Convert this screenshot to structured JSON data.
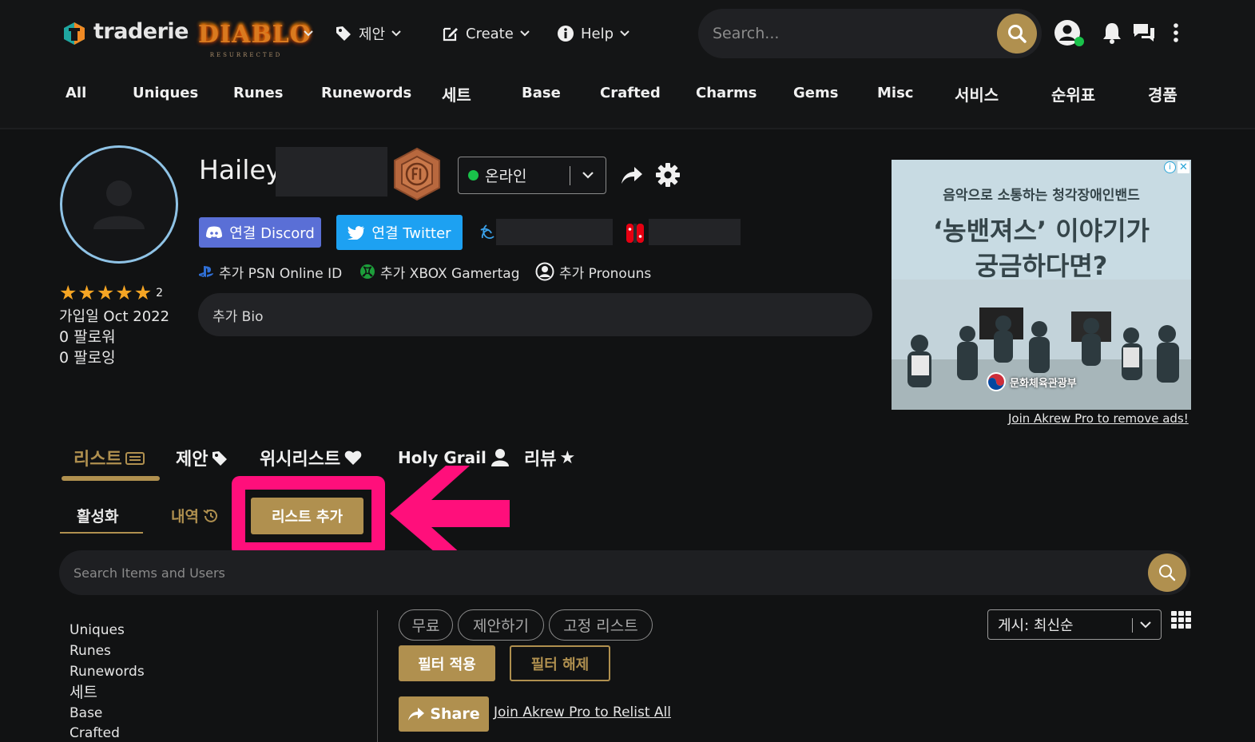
{
  "header": {
    "logo_text": "traderie",
    "game_logo_title": "DIABLO",
    "game_logo_sub": "RESURRECTED",
    "nav": [
      {
        "label": "제안"
      },
      {
        "label": "Create"
      },
      {
        "label": "Help"
      }
    ],
    "search_placeholder": "Search..."
  },
  "categories": [
    "All",
    "Uniques",
    "Runes",
    "Runewords",
    "세트",
    "Base",
    "Crafted",
    "Charms",
    "Gems",
    "Misc",
    "서비스",
    "순위표",
    "경품"
  ],
  "profile": {
    "username": "Hailey",
    "status": "온라인",
    "discord_label": "연결 Discord",
    "twitter_label": "연결 Twitter",
    "psn_label": "추가 PSN Online ID",
    "xbox_label": "추가 XBOX Gamertag",
    "pronouns_label": "추가 Pronouns",
    "bio_label": "추가 Bio",
    "rating_count": "2",
    "joined": "가입일 Oct 2022",
    "followers": "0  팔로워",
    "following": "0  팔로잉"
  },
  "ad": {
    "line1": "음악으로 소통하는 청각장애인밴드",
    "line2": "‘농밴져스’ 이야기가",
    "line3": "궁금하다면?",
    "sponsor": "문화체육관광부",
    "remove_ads": "Join Akrew Pro to remove ads!"
  },
  "tabs": [
    {
      "label": "리스트",
      "icon": "list-icon"
    },
    {
      "label": "제안",
      "icon": "tag-icon"
    },
    {
      "label": "위시리스트",
      "icon": "heart-icon"
    },
    {
      "label": "Holy Grail",
      "icon": "user-icon"
    },
    {
      "label": "리뷰",
      "icon": "star-icon"
    }
  ],
  "subtabs": {
    "active": "활성화",
    "history": "내역",
    "add_listing": "리스트 추가"
  },
  "items_search_placeholder": "Search Items and Users",
  "sidebar_items": [
    "Uniques",
    "Runes",
    "Runewords",
    "세트",
    "Base",
    "Crafted"
  ],
  "filters": {
    "chips": [
      "무료",
      "제안하기",
      "고정 리스트"
    ],
    "apply": "필터 적용",
    "clear": "필터 해제",
    "share": "Share",
    "relist": "Join Akrew Pro to Relist All",
    "sort": "게시: 최신순"
  },
  "colors": {
    "gold": "#b0904f",
    "highlight": "#ff0f7b",
    "discord": "#5a6fd6",
    "twitter": "#1da1f2",
    "online": "#19c24a",
    "star": "#f5a524"
  }
}
